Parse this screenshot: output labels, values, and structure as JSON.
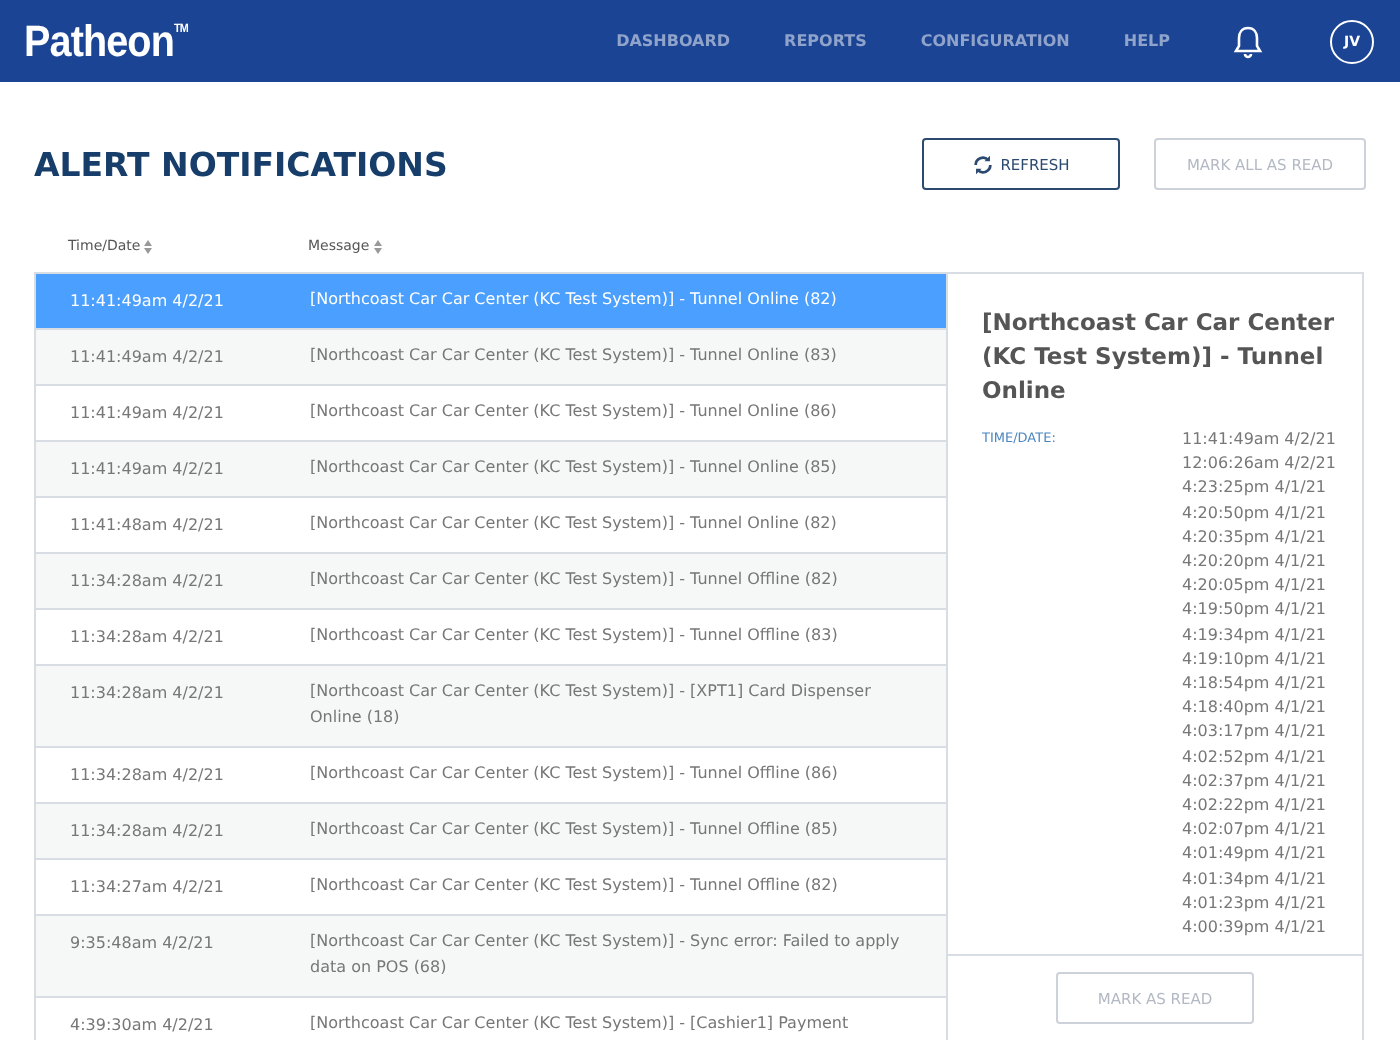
{
  "header": {
    "logo": "Patheon$^{TM}$",
    "nav": [
      {
        "label": "DASHBOARD"
      },
      {
        "label": "REPORTS"
      },
      {
        "label": "CONFIGURATION"
      },
      {
        "label": "HELP"
      }
    ],
    "avatar": "JV"
  },
  "page": {
    "title": "ALERT NOTIFICATIONS",
    "refresh": "REFRESH",
    "mark_all": {
      "label": "MARK ALL AS READ",
      "disabled": true
    }
  },
  "table": {
    "columns": [
      "Time/Date",
      "Message"
    ],
    "rows": [
      {
        "time": "11:41:49am 4/2/21",
        "message": "[Northcoast Car Car Center (KC Test System)] - Tunnel Online (82)",
        "selected": true
      },
      {
        "time": "11:41:49am 4/2/21",
        "message": "[Northcoast Car Car Center (KC Test System)] - Tunnel Online (83)",
        "selected": false
      },
      {
        "time": "11:41:49am 4/2/21",
        "message": "[Northcoast Car Car Center (KC Test System)] - Tunnel Online (86)",
        "selected": false
      },
      {
        "time": "11:41:49am 4/2/21",
        "message": "[Northcoast Car Car Center (KC Test System)] - Tunnel Online (85)",
        "selected": false
      },
      {
        "time": "11:41:48am 4/2/21",
        "message": "[Northcoast Car Car Center (KC Test System)] - Tunnel Online (82)",
        "selected": false
      },
      {
        "time": "11:34:28am 4/2/21",
        "message": "[Northcoast Car Car Center (KC Test System)] - Tunnel Offline (82)",
        "selected": false
      },
      {
        "time": "11:34:28am 4/2/21",
        "message": "[Northcoast Car Car Center (KC Test System)] - Tunnel Offline (83)",
        "selected": false
      },
      {
        "time": "11:34:28am 4/2/21",
        "message": "[Northcoast Car Car Center (KC Test System)] - [XPT1] Card Dispenser Online (18)",
        "selected": false
      },
      {
        "time": "11:34:28am 4/2/21",
        "message": "[Northcoast Car Car Center (KC Test System)] - Tunnel Offline (86)",
        "selected": false
      },
      {
        "time": "11:34:28am 4/2/21",
        "message": "[Northcoast Car Car Center (KC Test System)] - Tunnel Offline (85)",
        "selected": false
      },
      {
        "time": "11:34:27am 4/2/21",
        "message": "[Northcoast Car Car Center (KC Test System)] - Tunnel Offline (82)",
        "selected": false
      },
      {
        "time": "9:35:48am 4/2/21",
        "message": "[Northcoast Car Car Center (KC Test System)] - Sync error: Failed to apply data on POS (68)",
        "selected": false
      },
      {
        "time": "4:39:30am 4/2/21",
        "message": "[Northcoast Car Car Center (KC Test System)] - [Cashier1] Payment",
        "selected": false
      }
    ]
  },
  "detail": {
    "title": "[Northcoast Car Car Center (KC Test System)] - Tunnel Online",
    "label": "TIME/DATE:",
    "times": [
      "11:41:49am 4/2/21",
      "12:06:26am 4/2/21",
      "4:23:25pm 4/1/21",
      "4:20:50pm 4/1/21",
      "4:20:35pm 4/1/21",
      "4:20:20pm 4/1/21",
      "4:20:05pm 4/1/21",
      "4:19:50pm 4/1/21",
      "4:19:34pm 4/1/21",
      "4:19:10pm 4/1/21",
      "4:18:54pm 4/1/21",
      "4:18:40pm 4/1/21",
      "4:03:17pm 4/1/21",
      "4:02:52pm 4/1/21",
      "4:02:37pm 4/1/21",
      "4:02:22pm 4/1/21",
      "4:02:07pm 4/1/21",
      "4:01:49pm 4/1/21",
      "4:01:34pm 4/1/21",
      "4:01:23pm 4/1/21",
      "4:00:39pm 4/1/21"
    ],
    "mark_read": {
      "label": "MARK AS READ",
      "disabled": true
    }
  }
}
